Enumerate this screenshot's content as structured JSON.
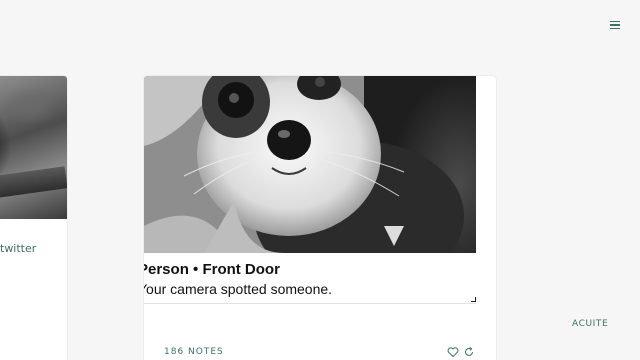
{
  "header": {
    "menu_icon": "hamburger-menu-icon"
  },
  "left_card": {
    "link_text": "twitter"
  },
  "main_card": {
    "notification": {
      "title": "Person • Front Door",
      "body": "Your camera spotted someone."
    },
    "notes_label": "186 NOTES",
    "like_icon": "heart-icon",
    "reblog_icon": "reblog-icon"
  },
  "footer": {
    "credit": "ACUITE"
  },
  "colors": {
    "accent": "#3e6f66",
    "background": "#f6f6f6",
    "card": "#ffffff"
  }
}
